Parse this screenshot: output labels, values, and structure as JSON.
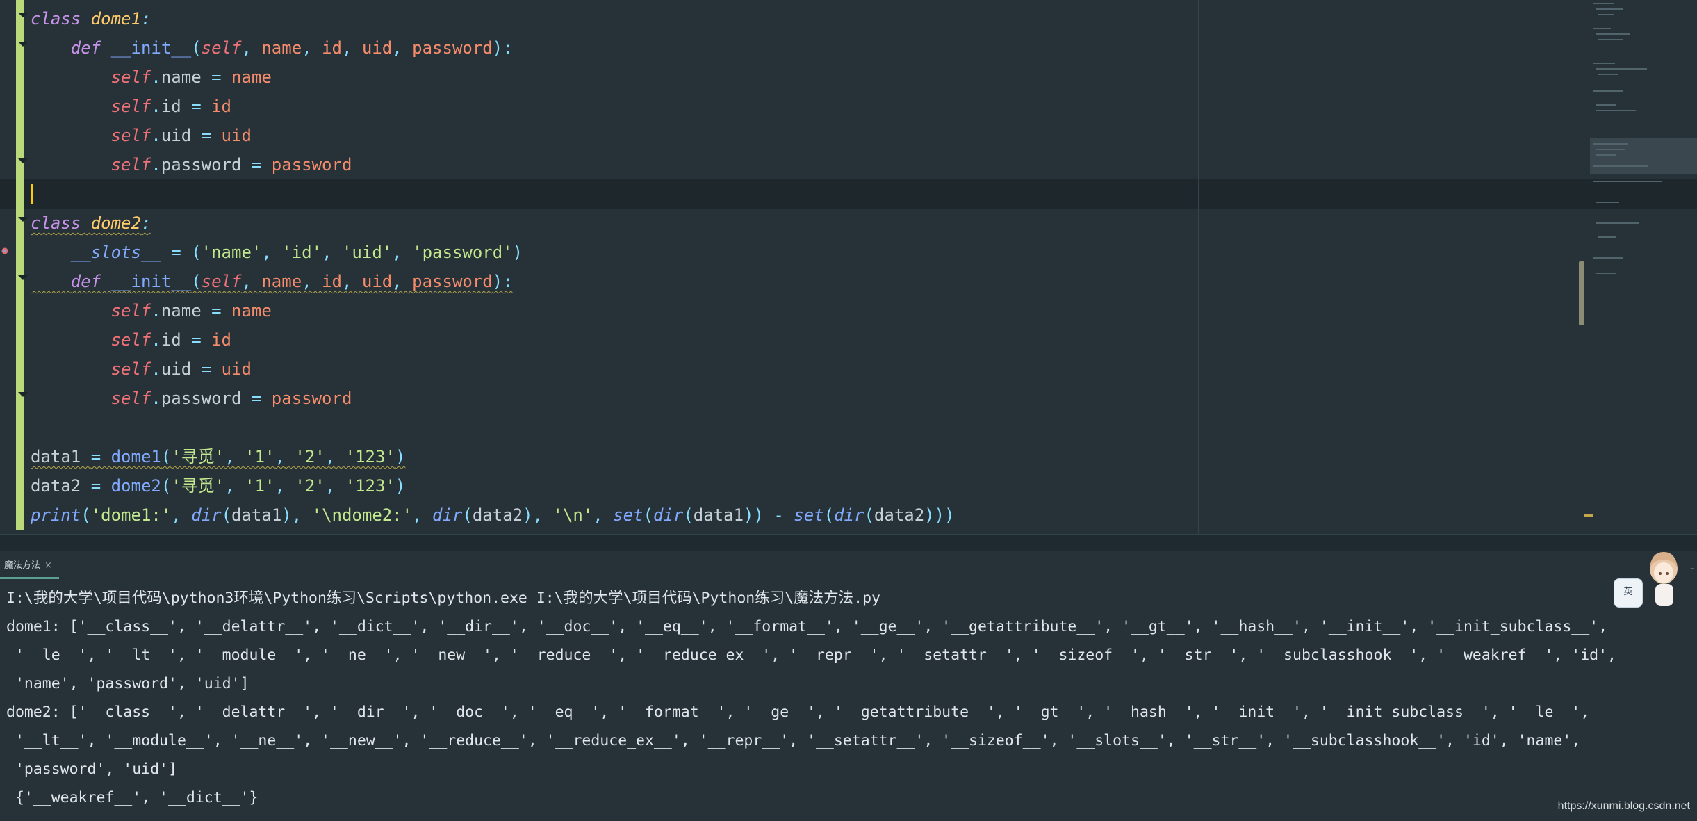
{
  "editor": {
    "code_lines": [
      "class dome1:",
      "    def __init__(self, name, id, uid, password):",
      "        self.name = name",
      "        self.id = id",
      "        self.uid = uid",
      "        self.password = password",
      "",
      "class dome2:",
      "    __slots__ = ('name', 'id', 'uid', 'password')",
      "    def __init__(self, name, id, uid, password):",
      "        self.name = name",
      "        self.id = id",
      "        self.uid = uid",
      "        self.password = password",
      "",
      "data1 = dome1('寻觅', '1', '2', '123')",
      "data2 = dome2('寻觅', '1', '2', '123')",
      "print('dome1:', dir(data1), '\\ndome2:', dir(data2), '\\n', set(dir(data1)) - set(dir(data2)))"
    ]
  },
  "run_panel": {
    "tab_label": "魔法方法",
    "tab_close": "×",
    "edge_mark": "-",
    "output_lines": [
      "I:\\我的大学\\项目代码\\python3环境\\Python练习\\Scripts\\python.exe I:\\我的大学\\项目代码\\Python练习\\魔法方法.py",
      "dome1: ['__class__', '__delattr__', '__dict__', '__dir__', '__doc__', '__eq__', '__format__', '__ge__', '__getattribute__', '__gt__', '__hash__', '__init__', '__init_subclass__',",
      " '__le__', '__lt__', '__module__', '__ne__', '__new__', '__reduce__', '__reduce_ex__', '__repr__', '__setattr__', '__sizeof__', '__str__', '__subclasshook__', '__weakref__', 'id',",
      " 'name', 'password', 'uid']",
      "dome2: ['__class__', '__delattr__', '__dir__', '__doc__', '__eq__', '__format__', '__ge__', '__getattribute__', '__gt__', '__hash__', '__init__', '__init_subclass__', '__le__',",
      " '__lt__', '__module__', '__ne__', '__new__', '__reduce__', '__reduce_ex__', '__repr__', '__setattr__', '__sizeof__', '__slots__', '__str__', '__subclasshook__', 'id', 'name',",
      " 'password', 'uid']",
      " {'__weakref__', '__dict__'}"
    ]
  },
  "ime": {
    "label": "英"
  },
  "watermark": "https://xunmi.blog.csdn.net",
  "colors": {
    "background": "#263238",
    "keyword": "#c792ea",
    "class_name": "#ffcb6b",
    "string": "#c3e88d",
    "parameter": "#f78c6c",
    "self": "#f07178",
    "change_stripe": "#b9d97a",
    "caret": "#ffcc00"
  }
}
